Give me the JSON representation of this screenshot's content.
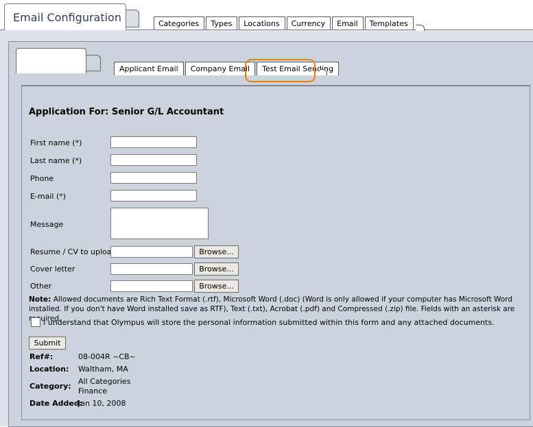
{
  "header": {
    "title": "Email Configuration",
    "tabs": [
      {
        "label": "Categories"
      },
      {
        "label": "Types"
      },
      {
        "label": "Locations"
      },
      {
        "label": "Currency"
      },
      {
        "label": "Email"
      },
      {
        "label": "Templates"
      }
    ]
  },
  "subtabs": [
    {
      "label": "Applicant Email"
    },
    {
      "label": "Company Email"
    },
    {
      "label": "Test Email Sending"
    }
  ],
  "form": {
    "heading": "Application For: Senior G/L Accountant",
    "first_name_label": "First name (*)",
    "last_name_label": "Last name (*)",
    "phone_label": "Phone",
    "email_label": "E-mail (*)",
    "message_label": "Message",
    "resume_label": "Resume / CV to upload",
    "cover_letter_label": "Cover letter",
    "other_label": "Other",
    "browse_label": "Browse...",
    "note_prefix": "Note:",
    "note_text": "Allowed documents are Rich Text Format (.rtf), Microsoft Word (.doc) (Word is only allowed if your computer has Microsoft Word installed. If you don't have Word installed save as RTF), Text (.txt), Acrobat (.pdf) and Compressed (.zip) file. Fields with an asterisk are required.",
    "consent_text": "I understand that Olympus will store the personal information submitted within this form and any attached documents.",
    "submit_label": "Submit"
  },
  "job": {
    "ref_label": "Ref#:",
    "ref_value": "08-004R ~CB~",
    "location_label": "Location:",
    "location_value": "Waltham, MA",
    "category_label": "Category:",
    "category_value_1": "All Categories",
    "category_value_2": "Finance",
    "date_label": "Date Added:",
    "date_value": "Jan 10, 2008"
  },
  "colors": {
    "highlight": "#f07c15",
    "panel_bg": "#cdd3dd",
    "title_text": "#2f3f5a"
  }
}
